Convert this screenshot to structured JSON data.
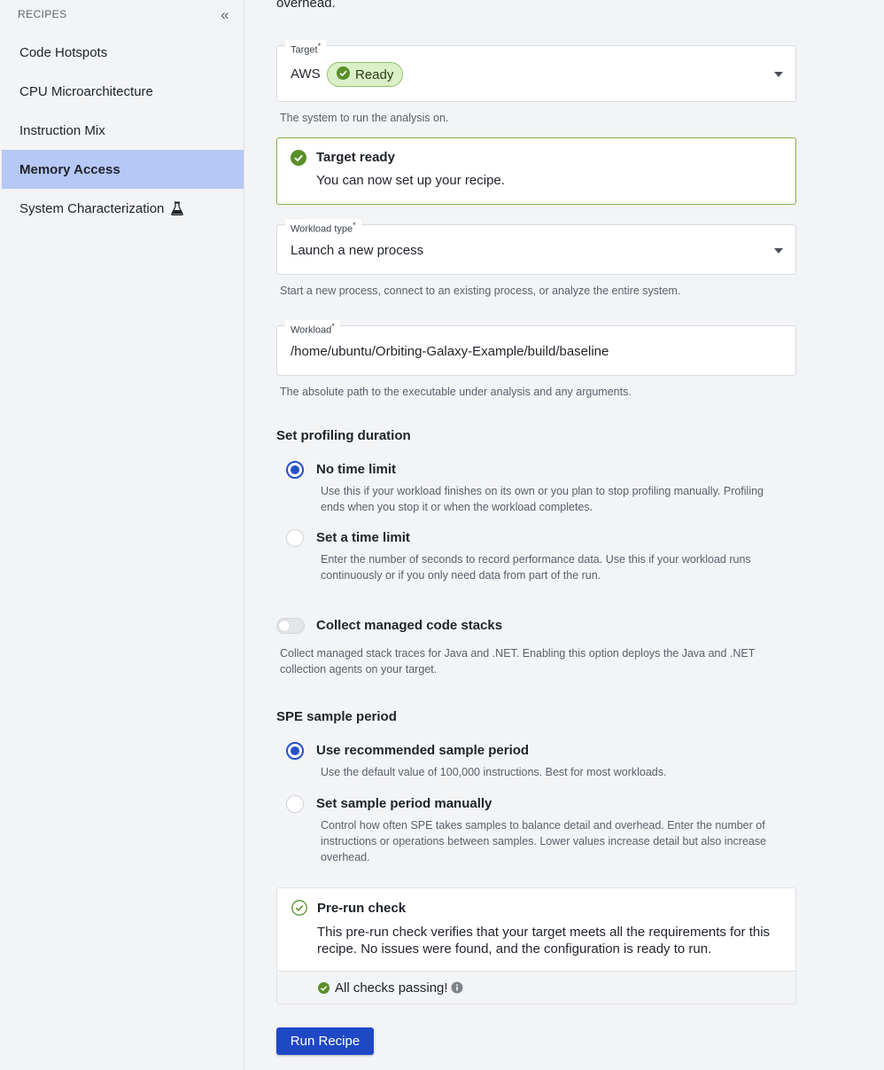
{
  "sidebar": {
    "header": "RECIPES",
    "items": [
      {
        "label": "Code Hotspots"
      },
      {
        "label": "CPU Microarchitecture"
      },
      {
        "label": "Instruction Mix"
      },
      {
        "label": "Memory Access",
        "active": true
      },
      {
        "label": "System Characterization",
        "icon": "beaker-icon"
      }
    ]
  },
  "main": {
    "top_text": "overhead.",
    "target": {
      "label": "Target",
      "required_mark": "*",
      "value": "AWS",
      "badge": "Ready",
      "helper": "The system to run the analysis on."
    },
    "target_status": {
      "title": "Target ready",
      "message": "You can now set up your recipe."
    },
    "workload_type": {
      "label": "Workload type",
      "required_mark": "*",
      "value": "Launch a new process",
      "helper": "Start a new process, connect to an existing process, or analyze the entire system."
    },
    "workload": {
      "label": "Workload",
      "required_mark": "*",
      "value": "/home/ubuntu/Orbiting-Galaxy-Example/build/baseline",
      "helper": "The absolute path to the executable under analysis and any arguments."
    },
    "profiling_duration": {
      "title": "Set profiling duration",
      "options": [
        {
          "label": "No time limit",
          "desc": "Use this if your workload finishes on its own or you plan to stop profiling manually. Profiling ends when you stop it or when the workload completes.",
          "checked": true
        },
        {
          "label": "Set a time limit",
          "desc": "Enter the number of seconds to record performance data. Use this if your workload runs continuously or if you only need data from part of the run.",
          "checked": false
        }
      ]
    },
    "managed_stacks": {
      "label": "Collect managed code stacks",
      "desc": "Collect managed stack traces for Java and .NET. Enabling this option deploys the Java and .NET collection agents on your target.",
      "enabled": false
    },
    "spe_period": {
      "title": "SPE sample period",
      "options": [
        {
          "label": "Use recommended sample period",
          "desc": "Use the default value of 100,000 instructions. Best for most workloads.",
          "checked": true
        },
        {
          "label": "Set sample period manually",
          "desc": "Control how often SPE takes samples to balance detail and overhead. Enter the number of instructions or operations between samples. Lower values increase detail but also increase overhead.",
          "checked": false
        }
      ]
    },
    "precheck": {
      "title": "Pre-run check",
      "message": "This pre-run check verifies that your target meets all the requirements for this recipe. No issues were found, and the configuration is ready to run.",
      "status": "All checks passing!"
    },
    "run_button": "Run Recipe"
  },
  "colors": {
    "accent": "#1f48c7",
    "success": "#5a8f29",
    "active_nav": "#b5c8f6"
  }
}
